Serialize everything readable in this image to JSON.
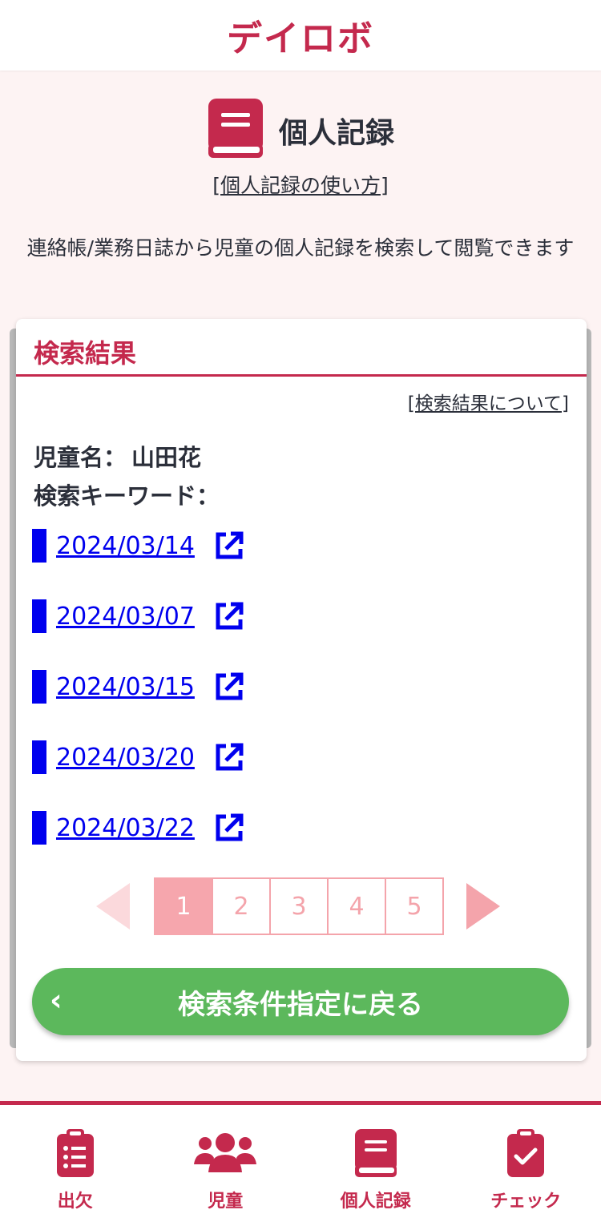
{
  "header": {
    "brand": "デイロボ"
  },
  "page": {
    "title": "個人記録",
    "howto_link": "[個人記録の使い方]",
    "description": "連絡帳/業務日誌から児童の個人記録を検索して閲覧できます"
  },
  "results_card": {
    "title": "検索結果",
    "about_link": "[検索結果について]",
    "child_label": "児童名：",
    "child_value": "山田花",
    "keyword_label": "検索キーワード：",
    "keyword_value": "",
    "results": [
      {
        "date": "2024/03/14"
      },
      {
        "date": "2024/03/07"
      },
      {
        "date": "2024/03/15"
      },
      {
        "date": "2024/03/20"
      },
      {
        "date": "2024/03/22"
      }
    ],
    "pagination": {
      "pages": [
        "1",
        "2",
        "3",
        "4",
        "5"
      ],
      "current": "1"
    },
    "back_button": "検索条件指定に戻る"
  },
  "bottom_nav": {
    "items": [
      {
        "label": "出欠",
        "icon": "clipboard-list-icon"
      },
      {
        "label": "児童",
        "icon": "users-icon"
      },
      {
        "label": "個人記録",
        "icon": "book-icon"
      },
      {
        "label": "チェック",
        "icon": "clipboard-check-icon"
      }
    ]
  },
  "colors": {
    "brand": "#c4294d",
    "link": "#0000ee",
    "button_green": "#5cb85c",
    "pager_pink": "#f4a4ab",
    "page_background": "#fdf3f3"
  }
}
